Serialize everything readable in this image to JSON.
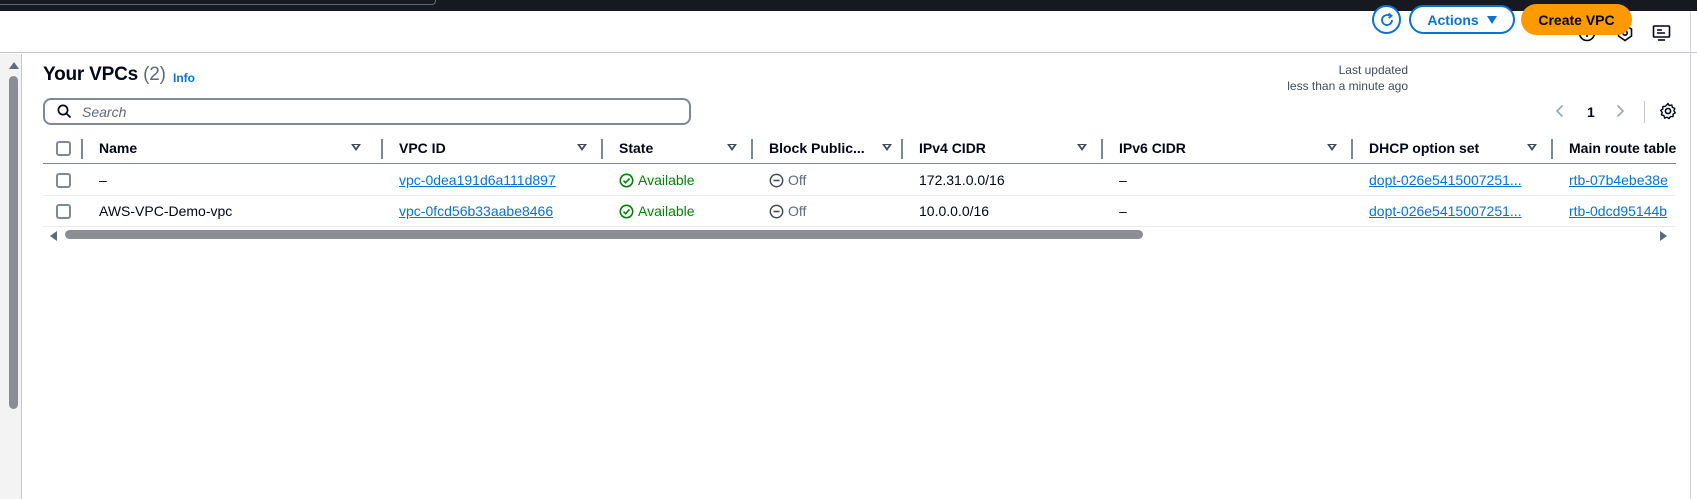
{
  "header": {
    "title": "Your VPCs",
    "count": "(2)",
    "info": "Info",
    "last_updated_line1": "Last updated",
    "last_updated_line2": "less than a minute ago",
    "actions_label": "Actions",
    "create_label": "Create VPC"
  },
  "search": {
    "placeholder": "Search",
    "value": ""
  },
  "pagination": {
    "current_page": "1"
  },
  "table": {
    "columns": [
      "Name",
      "VPC ID",
      "State",
      "Block Public...",
      "IPv4 CIDR",
      "IPv6 CIDR",
      "DHCP option set",
      "Main route table"
    ],
    "rows": [
      {
        "name": "–",
        "vpc_id": "vpc-0dea191d6a111d897",
        "state": "Available",
        "block_public": "Off",
        "ipv4": "172.31.0.0/16",
        "ipv6": "–",
        "dhcp": "dopt-026e5415007251...",
        "route_table": "rtb-07b4ebe38e"
      },
      {
        "name": "AWS-VPC-Demo-vpc",
        "vpc_id": "vpc-0fcd56b33aabe8466",
        "state": "Available",
        "block_public": "Off",
        "ipv4": "10.0.0.0/16",
        "ipv6": "–",
        "dhcp": "dopt-026e5415007251...",
        "route_table": "rtb-0dcd95144b"
      }
    ]
  },
  "colors": {
    "primary": "#0972d3",
    "create_button": "#ff9900",
    "success": "#037f0c"
  }
}
